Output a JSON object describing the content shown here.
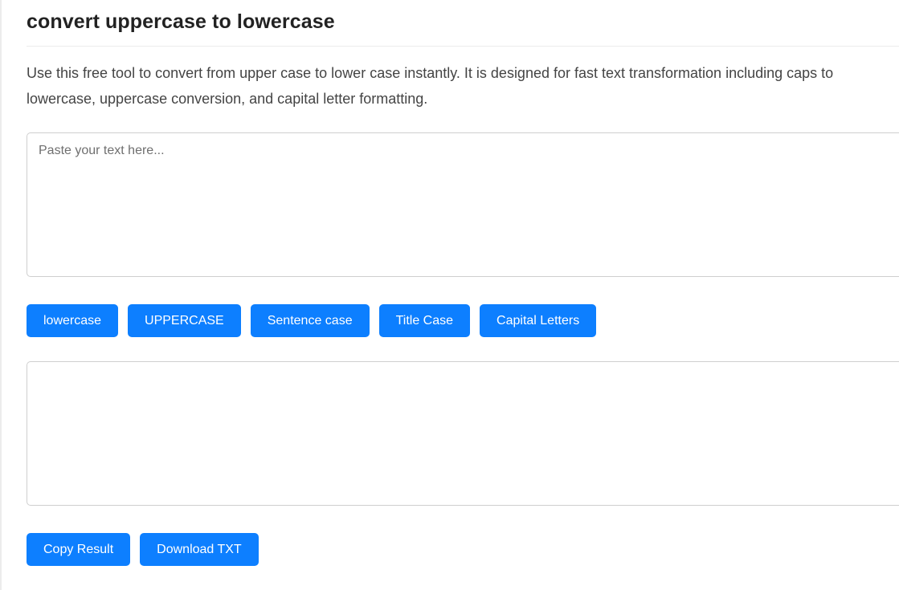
{
  "page": {
    "title": "convert uppercase to lowercase",
    "description": "Use this free tool to convert from upper case to lower case instantly. It is designed for fast text transformation including caps to lowercase, uppercase conversion, and capital letter formatting."
  },
  "input": {
    "placeholder": "Paste your text here...",
    "value": ""
  },
  "case_buttons": {
    "lowercase": "lowercase",
    "uppercase": "UPPERCASE",
    "sentence": "Sentence case",
    "title": "Title Case",
    "capital": "Capital Letters"
  },
  "output": {
    "value": ""
  },
  "actions": {
    "copy": "Copy Result",
    "download": "Download TXT"
  },
  "colors": {
    "button_bg": "#0d7fff",
    "button_text": "#ffffff",
    "border": "#cfcfcf"
  }
}
